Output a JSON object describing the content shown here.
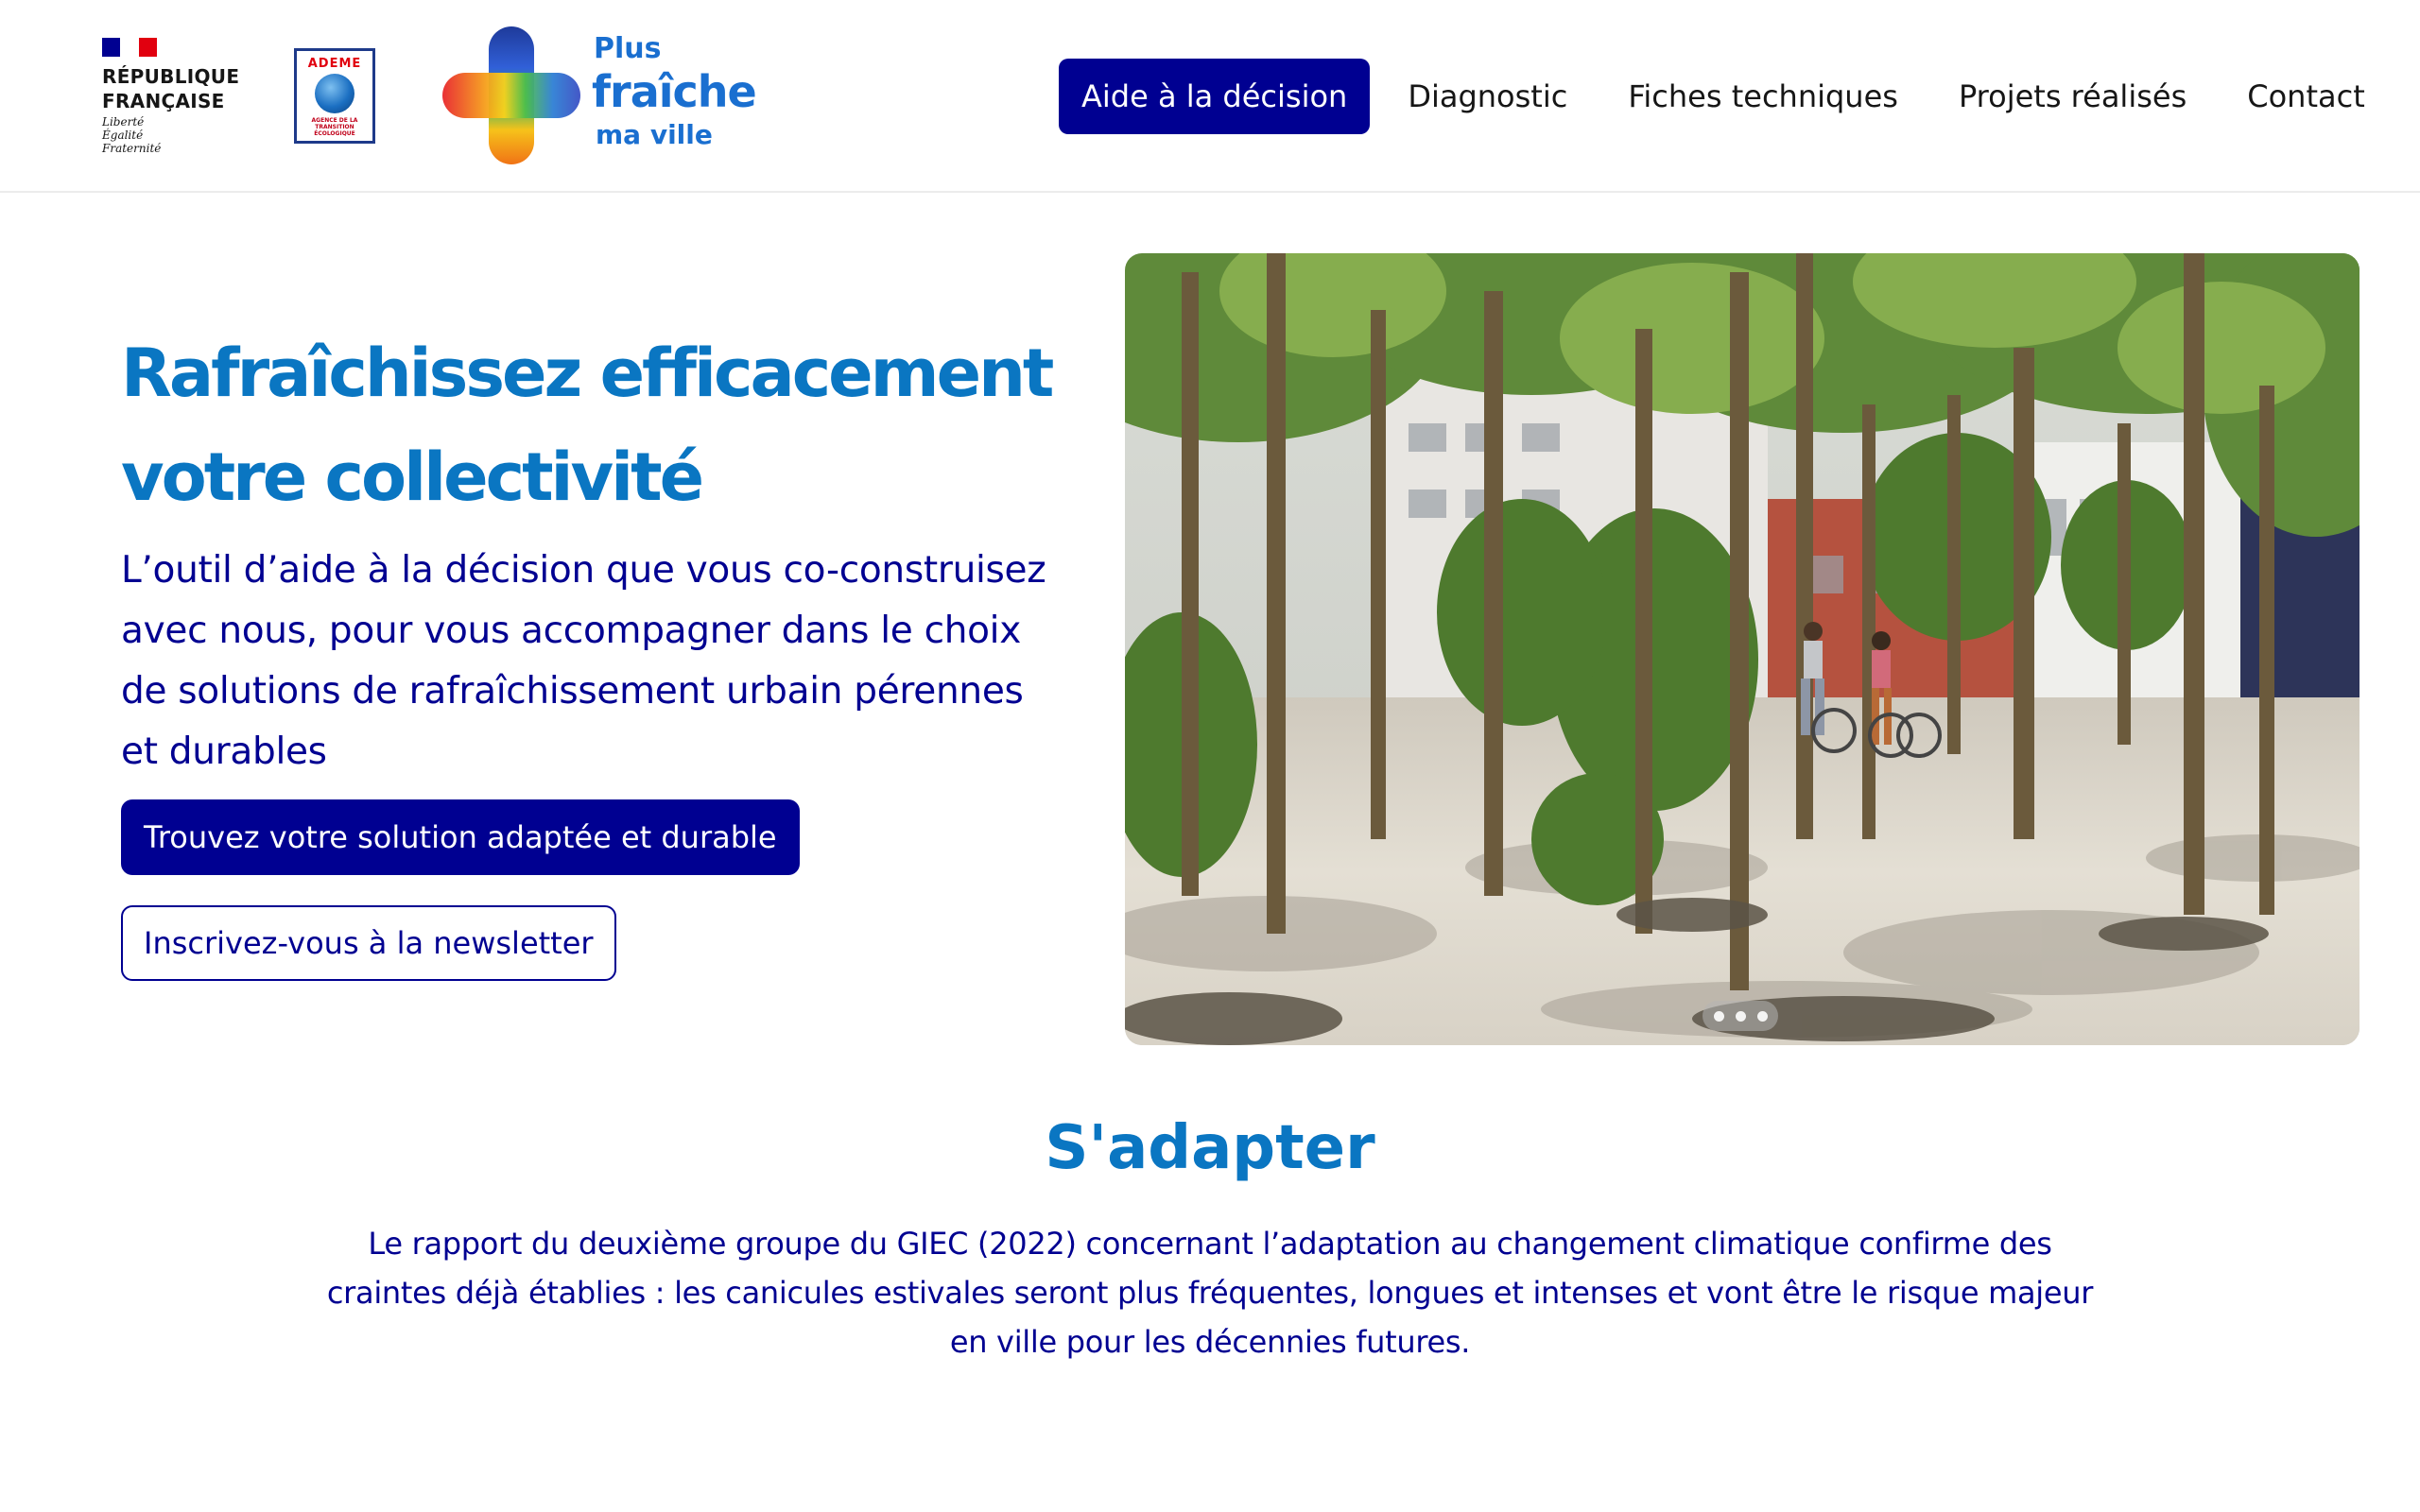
{
  "header": {
    "republique": {
      "name": "RÉPUBLIQUE\nFRANÇAISE",
      "motto": "Liberté\nÉgalité\nFraternité"
    },
    "ademe": {
      "title": "ADEME",
      "subtitle": "AGENCE DE LA\nTRANSITION\nÉCOLOGIQUE"
    },
    "brand": {
      "line1": "Plus",
      "line2": "fraîche",
      "line3": "ma ville"
    },
    "nav": [
      {
        "label": "Aide à la décision",
        "active": true
      },
      {
        "label": "Diagnostic",
        "active": false
      },
      {
        "label": "Fiches techniques",
        "active": false
      },
      {
        "label": "Projets réalisés",
        "active": false
      },
      {
        "label": "Contact",
        "active": false
      }
    ]
  },
  "hero": {
    "title": "Rafraîchissez efficacement\nvotre collectivité",
    "subtitle": "L’outil d’aide à la décision que vous co-construisez avec nous, pour vous accompagner dans le choix de solutions de rafraîchissement urbain pérennes et durables",
    "primary_button": "Trouvez votre solution adaptée et durable",
    "secondary_button": "Inscrivez-vous à la newsletter"
  },
  "carousel": {
    "slide_count": 3,
    "active_slide": 1
  },
  "section": {
    "title": "S'adapter",
    "text": "Le rapport du deuxième groupe du GIEC (2022) concernant l’adaptation au changement climatique confirme des craintes déjà établies : les canicules estivales seront plus fréquentes, longues et intenses et vont être le risque majeur en ville pour les décennies futures."
  },
  "colors": {
    "primary": "#000091",
    "title_blue": "#0a76c2",
    "text": "#161616"
  }
}
